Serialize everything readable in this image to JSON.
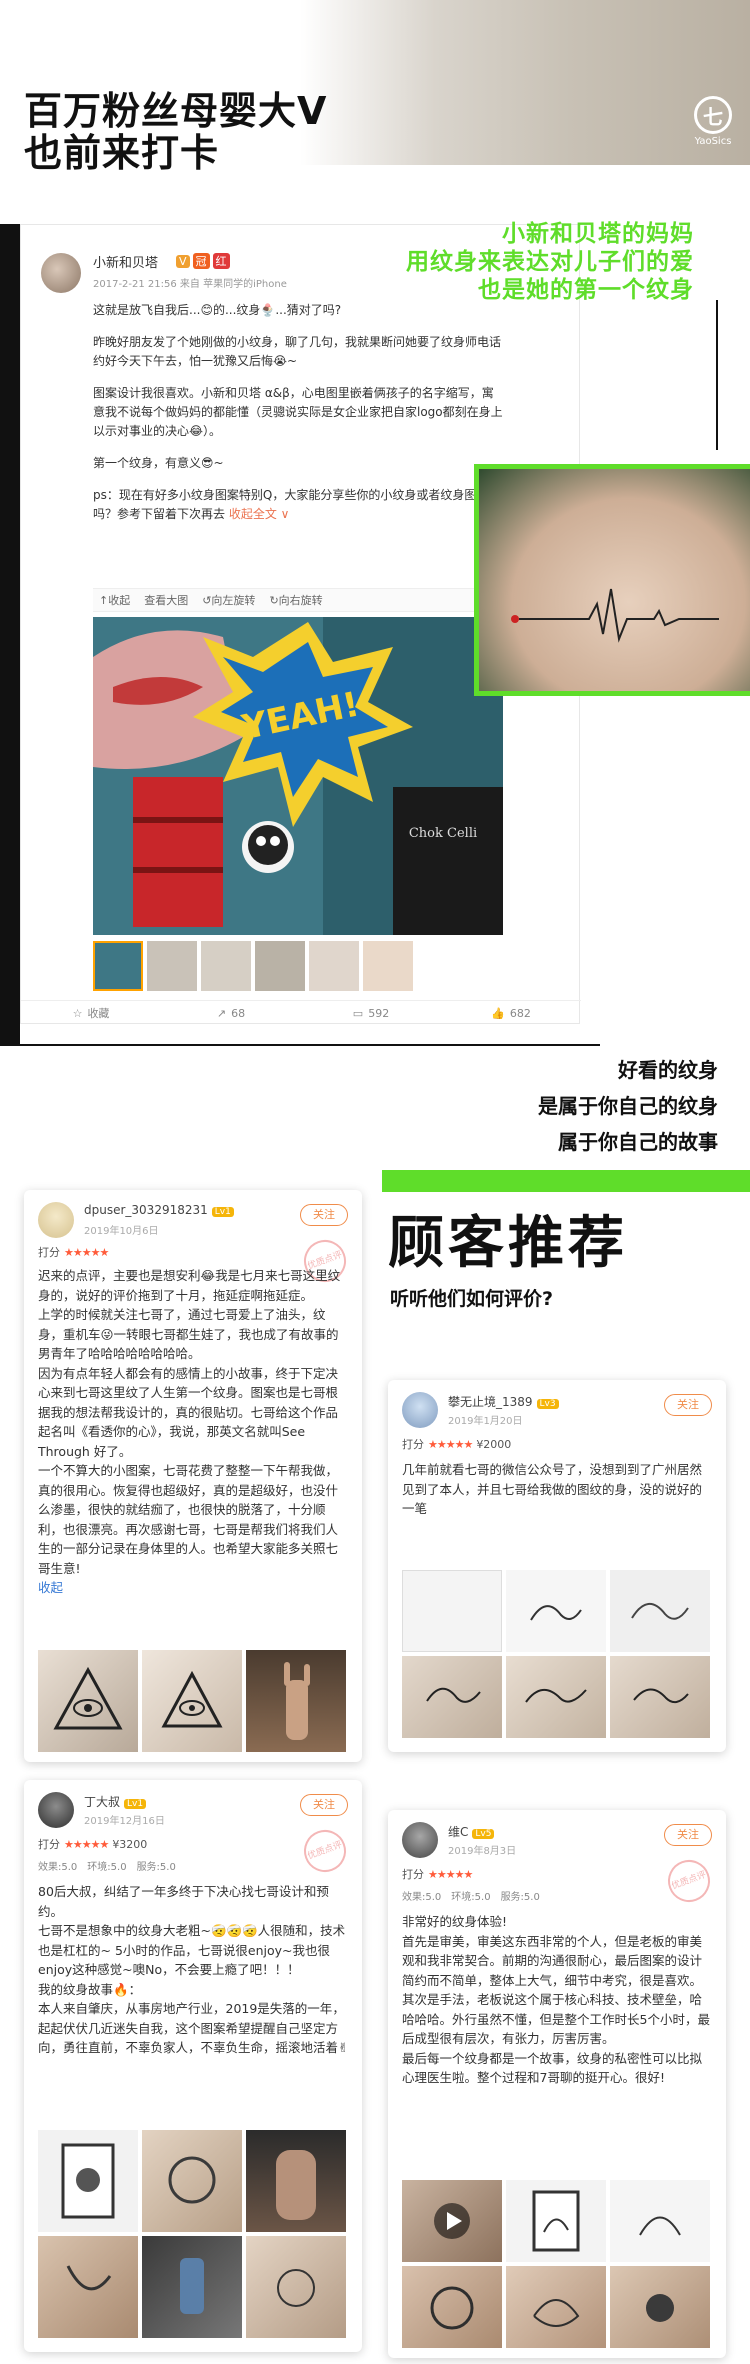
{
  "header": {
    "title_line1": "百万粉丝母婴大V",
    "title_line2": "也前来打卡",
    "brand_letter": "七",
    "brand_name": "YaoSics"
  },
  "weibo": {
    "username": "小新和贝塔",
    "badges": [
      "V",
      "冠",
      "红"
    ],
    "time": "2017-2-21 21:56 来自 苹果同学的iPhone",
    "paragraphs": [
      "这就是放飞自我后...😊的...纹身🍨...猜对了吗?",
      "昨晚好朋友发了个她刚做的小纹身，聊了几句，我就果断问她要了纹身师电话约好今天下午去，怕一犹豫又后悔😭~",
      "图案设计我很喜欢。小新和贝塔 α&β，心电图里嵌着俩孩子的名字缩写，寓意我不说每个做妈妈的都能懂（灵骢说实际是女企业家把自家logo都刻在身上以示对事业的决心😂）。",
      "第一个纹身，有意义😎~",
      "ps：现在有好多小纹身图案特别Q，大家能分享些你的小纹身或者纹身图案吗？参考下留着下次再去"
    ],
    "more": "收起全文 ∨",
    "toolbar": [
      "↑收起",
      "查看大图",
      "↺向左旋转",
      "↻向右旋转"
    ],
    "sign_text": "YEAH!",
    "shop_text": "Chok Celli",
    "actions": [
      {
        "icon": "star-icon",
        "label": "收藏"
      },
      {
        "icon": "share-icon",
        "label": "68"
      },
      {
        "icon": "comment-icon",
        "label": "592"
      },
      {
        "icon": "like-icon",
        "label": "682"
      }
    ]
  },
  "caption_green": [
    "小新和贝塔的妈妈",
    "用纹身来表达对儿子们的爱",
    "也是她的第一个纹身"
  ],
  "story_lines": [
    "好看的纹身",
    "是属于你自己的纹身",
    "属于你自己的故事"
  ],
  "customers": {
    "title": "顾客推荐",
    "subtitle": "听听他们如何评价?"
  },
  "reviews": [
    {
      "name": "dpuser_3032918231",
      "level": "Lv1",
      "date": "2019年10月6日",
      "follow": "关注",
      "stamp": "优质点评",
      "rating_label": "打分",
      "stars": "★★★★★",
      "price": "",
      "scores": [],
      "text": [
        "迟来的点评，主要也是想安利😂我是七月来七哥这里纹身的，说好的评价拖到了十月，拖延症啊拖延症。",
        "上学的时候就关注七哥了，通过七哥爱上了油头，纹身，重机车😜一转眼七哥都生娃了，我也成了有故事的男青年了哈哈哈哈哈哈哈哈。",
        "因为有点年轻人都会有的感情上的小故事，终于下定决心来到七哥这里纹了人生第一个纹身。图案也是七哥根据我的想法帮我设计的，真的很贴切。七哥给这个作品起名叫《看透你的心》，我说，那英文名就叫See Through 好了。",
        "一个不算大的小图案，七哥花费了整整一下午帮我做，真的很用心。恢复得也超级好，真的是超级好，也没什么渗墨，很快的就结痂了，也很快的脱落了，十分顺利，也很漂亮。再次感谢七哥，七哥是帮我们将我们人生的一部分记录在身体里的人。也希望大家能多关照七哥生意!"
      ],
      "link": "收起"
    },
    {
      "name": "攀无止境_1389",
      "level": "Lv3",
      "date": "2019年1月20日",
      "follow": "关注",
      "stamp": "",
      "rating_label": "打分",
      "stars": "★★★★★",
      "price": "¥2000",
      "scores": [],
      "text": [
        "几年前就看七哥的微信公众号了，没想到到了广州居然见到了本人，并且七哥给我做的图纹的身，没的说好的一笔"
      ],
      "link": ""
    },
    {
      "name": "丁大叔",
      "level": "Lv1",
      "date": "2019年12月16日",
      "follow": "关注",
      "stamp": "优质点评",
      "rating_label": "打分",
      "stars": "★★★★★",
      "price": "¥3200",
      "scores": [
        "效果:5.0",
        "环境:5.0",
        "服务:5.0"
      ],
      "text": [
        "80后大叔，纠结了一年多终于下决心找七哥设计和预约。",
        "七哥不是想象中的纹身大老粗~🤕🤕🤕人很随和，技术也是杠杠的~ 5小时的作品，七哥说很enjoy~我也很enjoy这种感觉~噢No，不会要上瘾了吧！！！",
        "我的纹身故事🔥：",
        "本人来自肇庆，从事房地产行业，2019是失落的一年，起起伏伏几近迷失自我，这个图案希望提醒自己坚定方向，勇往直前，不辜负家人，不辜负生命，摇滚地活着✌"
      ],
      "link": ""
    },
    {
      "name": "维C",
      "level": "Lv5",
      "date": "2019年8月3日",
      "follow": "关注",
      "stamp": "优质点评",
      "rating_label": "打分",
      "stars": "★★★★★",
      "price": "",
      "scores": [
        "效果:5.0",
        "环境:5.0",
        "服务:5.0"
      ],
      "text": [
        "非常好的纹身体验!",
        "首先是审美，审美这东西非常的个人，但是老板的审美观和我非常契合。前期的沟通很耐心，最后图案的设计简约而不简单，整体上大气，细节中考究，很是喜欢。",
        "其次是手法，老板说这个属于核心科技、技术壁垒，哈哈哈哈。外行虽然不懂，但是整个工作时长5个小时，最后成型很有层次，有张力，厉害厉害。",
        "最后每一个纹身都是一个故事，纹身的私密性可以比拟心理医生啦。整个过程和7哥聊的挺开心。很好!"
      ],
      "link": ""
    }
  ],
  "colors": {
    "accent_green": "#5fdd2a",
    "star_red": "#ff5b3a",
    "follow_orange": "#f08c4a"
  }
}
